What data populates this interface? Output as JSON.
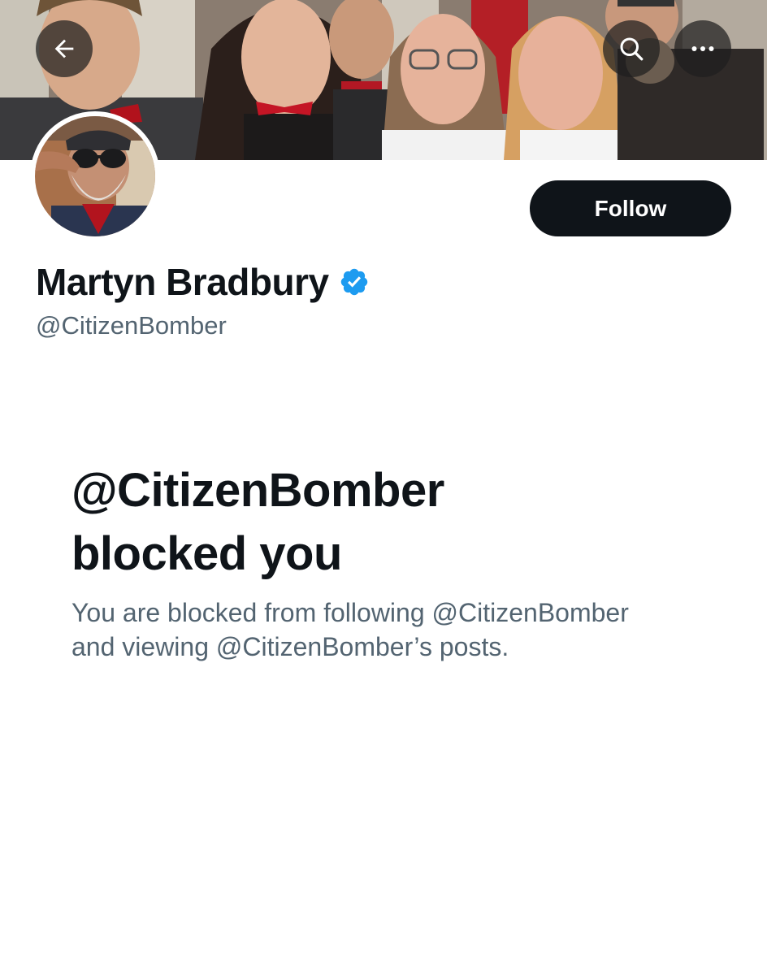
{
  "header": {
    "back_icon": "arrow-left-icon",
    "search_icon": "search-icon",
    "more_icon": "more-horizontal-icon",
    "banner_description": ""
  },
  "profile": {
    "display_name": "Martyn Bradbury",
    "handle": "@CitizenBomber",
    "verified": true,
    "verified_color": "#1d9bf0",
    "follow_label": "Follow"
  },
  "blocked": {
    "title_line1": "@CitizenBomber",
    "title_line2": "blocked you",
    "description_line1": "You are blocked from following @CitizenBomber",
    "description_line2": "and viewing @CitizenBomber’s posts."
  },
  "colors": {
    "primary_text": "#0f1419",
    "secondary_text": "#536471",
    "follow_button_bg": "#0f1419",
    "follow_button_text": "#ffffff",
    "verified_badge": "#1d9bf0"
  }
}
